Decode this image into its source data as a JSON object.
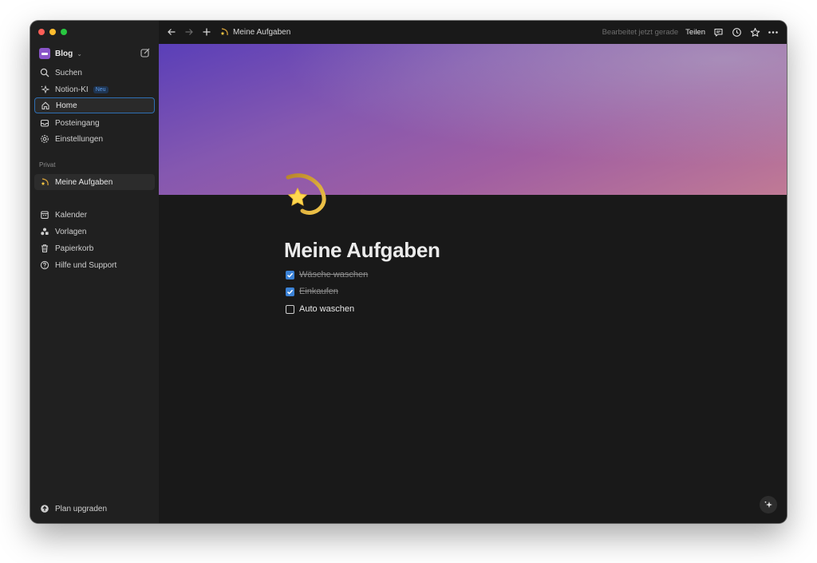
{
  "sidebar": {
    "workspace": "Blog",
    "nav": [
      {
        "label": "Suchen",
        "icon": "search-icon"
      },
      {
        "label": "Notion-KI",
        "icon": "sparkle-icon",
        "badge": "Neu"
      },
      {
        "label": "Home",
        "icon": "home-icon"
      },
      {
        "label": "Posteingang",
        "icon": "inbox-icon"
      },
      {
        "label": "Einstellungen",
        "icon": "gear-icon"
      }
    ],
    "section_label": "Privat",
    "pages": [
      {
        "label": "Meine Aufgaben",
        "icon": "shooting-star-icon"
      }
    ],
    "bottom_nav": [
      {
        "label": "Kalender",
        "icon": "calendar-icon"
      },
      {
        "label": "Vorlagen",
        "icon": "templates-icon"
      },
      {
        "label": "Papierkorb",
        "icon": "trash-icon"
      },
      {
        "label": "Hilfe und Support",
        "icon": "help-icon"
      }
    ],
    "upgrade": "Plan upgraden"
  },
  "topbar": {
    "breadcrumb": "Meine Aufgaben",
    "edited": "Bearbeitet jetzt gerade",
    "share": "Teilen"
  },
  "page": {
    "title": "Meine Aufgaben",
    "todos": [
      {
        "text": "Wäsche waschen",
        "checked": true
      },
      {
        "text": "Einkaufen",
        "checked": true
      },
      {
        "text": "Auto waschen",
        "checked": false
      }
    ]
  },
  "colors": {
    "accent": "#3b82d6",
    "sidebar_bg": "#202020",
    "main_bg": "#191919"
  }
}
